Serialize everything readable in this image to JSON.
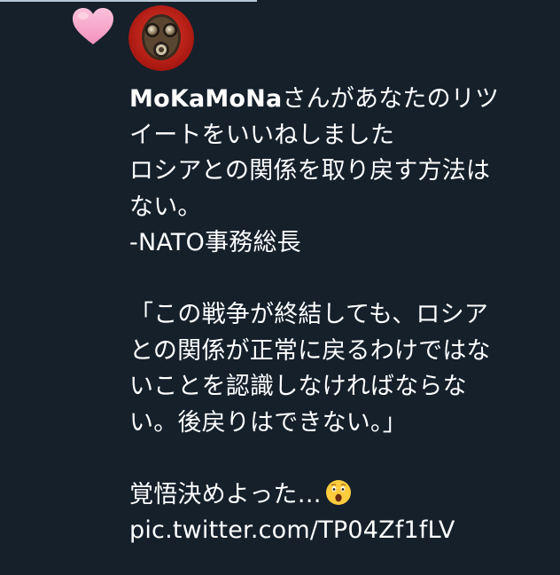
{
  "notification": {
    "icon": "heart-icon",
    "accent_color": "#f7a8c8",
    "avatar": "gas-mask-avatar",
    "username": "MoKaMoNa",
    "action_line1": "さんがあなたのリツ",
    "action_line2": "イートをいいねしました"
  },
  "tweet": {
    "lines": [
      "ロシアとの関係を取り戻す方法は",
      "ない。",
      "-NATO事務総長",
      "",
      "「この戦争が終結しても、ロシア",
      "との関係が正常に戻るわけではな",
      "いことを認識しなければならな",
      "い。後戻りはできない。」",
      ""
    ],
    "comment": "覚悟決めよった…",
    "comment_emoji": "astonished-face-icon",
    "link": "pic.twitter.com/TP04Zf1fLV"
  },
  "colors": {
    "background": "#15202b",
    "text": "#ffffff"
  }
}
